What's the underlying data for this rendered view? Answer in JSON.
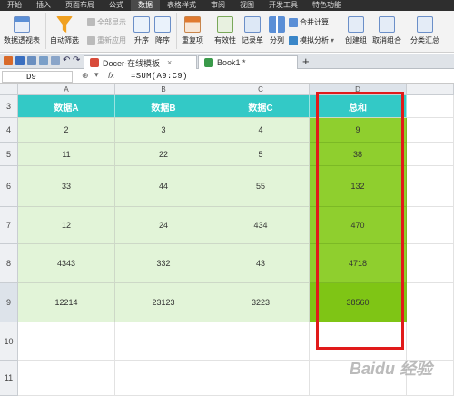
{
  "menu_tabs": [
    "开始",
    "插入",
    "页面布局",
    "公式",
    "数据",
    "表格样式",
    "审阅",
    "视图",
    "开发工具",
    "特色功能"
  ],
  "ribbon": {
    "pivot": "数据透视表",
    "autofilter": "自动筛选",
    "show_all": "全部显示",
    "reapply": "重新应用",
    "sort_asc": "升序",
    "sort_desc": "降序",
    "duplicates": "重复项",
    "validity": "有效性",
    "record": "记录单",
    "split": "分列",
    "consolidate": "合并计算",
    "whatif": "模拟分析",
    "group": "创建组",
    "ungroup": "取消组合",
    "subtotal": "分类汇总"
  },
  "doc_tabs": [
    {
      "label": "Docer-在线模板",
      "close": "×"
    },
    {
      "label": "Book1 *",
      "close": ""
    }
  ],
  "formula_bar": {
    "name_box": "D9",
    "fx": "fx",
    "formula": "=SUM(A9:C9)"
  },
  "columns": [
    "A",
    "B",
    "C",
    "D"
  ],
  "rows": [
    "3",
    "4",
    "5",
    "6",
    "7",
    "8",
    "9",
    "10",
    "11"
  ],
  "table": {
    "headers": [
      "数据A",
      "数据B",
      "数据C",
      "总和"
    ],
    "data": [
      [
        "2",
        "3",
        "4",
        "9"
      ],
      [
        "11",
        "22",
        "5",
        "38"
      ],
      [
        "33",
        "44",
        "55",
        "132"
      ],
      [
        "12",
        "24",
        "434",
        "470"
      ],
      [
        "4343",
        "332",
        "43",
        "4718"
      ],
      [
        "12214",
        "23123",
        "3223",
        "38560"
      ]
    ]
  },
  "watermark": "Baidu 经验",
  "colors": {
    "header": "#33c9c6",
    "data": "#e2f4d8",
    "sum": "#8fcf2e",
    "highlight": "#e11a1a"
  }
}
